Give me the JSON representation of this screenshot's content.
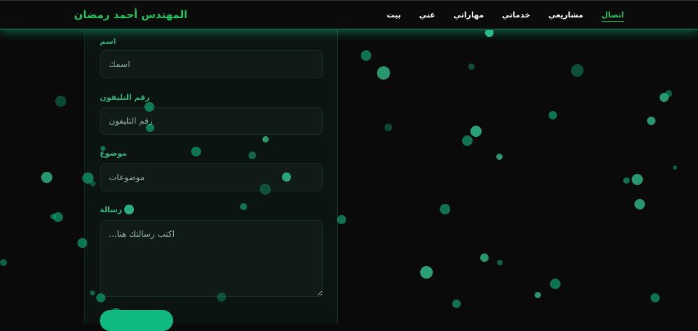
{
  "header": {
    "brand": "المهندس أحمد رمضان",
    "nav": [
      {
        "label": "اتصال",
        "active": true
      },
      {
        "label": "مشاريعي"
      },
      {
        "label": "خدماتي"
      },
      {
        "label": "مهاراتي"
      },
      {
        "label": "عني"
      },
      {
        "label": "بيت"
      }
    ]
  },
  "form": {
    "name": {
      "label": "اسم",
      "placeholder": "اسمك"
    },
    "phone": {
      "label": "رقم التليفون",
      "placeholder": "رقم التليفون"
    },
    "subject": {
      "label": "موضوع",
      "placeholder": "موضوعات"
    },
    "message": {
      "label": "رسالة",
      "placeholder": "...اكتب رسالتك هنا"
    }
  },
  "colors": {
    "accent": "#22c55e",
    "button": "#10b981"
  }
}
